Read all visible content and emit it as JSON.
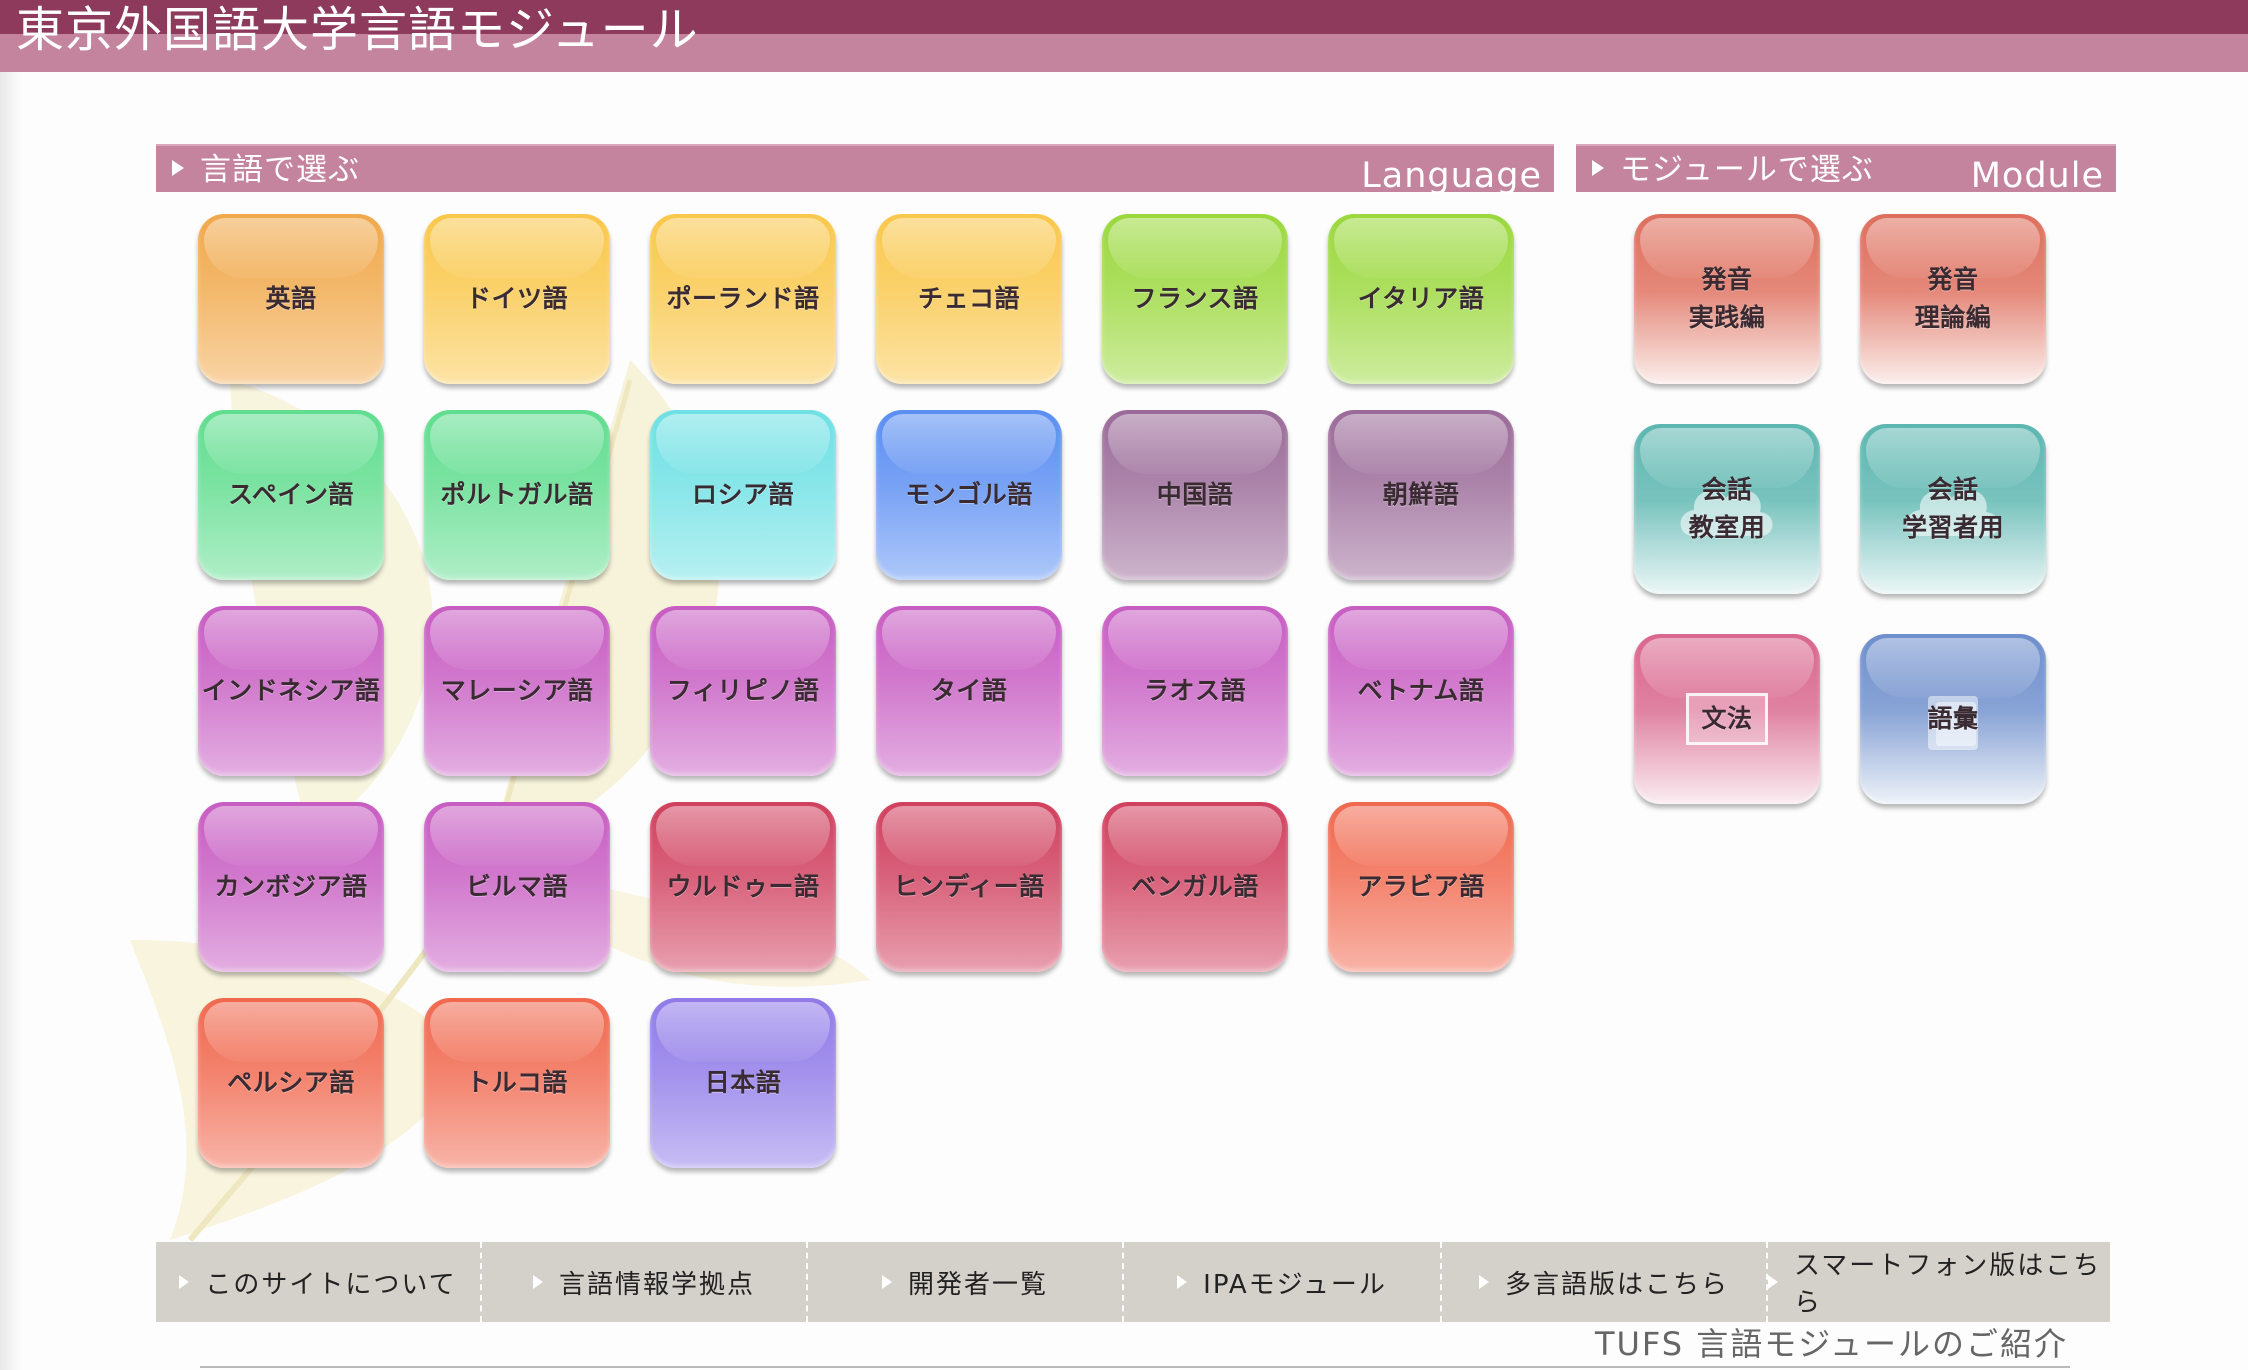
{
  "header": {
    "title": "東京外国語大学言語モジュール"
  },
  "language_section": {
    "label": "言語で選ぶ",
    "label_en": "Language"
  },
  "module_section": {
    "label": "モジュールで選ぶ",
    "label_en": "Module"
  },
  "languages": [
    {
      "label": "英語",
      "color": "#f0a84a"
    },
    {
      "label": "ドイツ語",
      "color": "#f9c74a"
    },
    {
      "label": "ポーランド語",
      "color": "#f9c74a"
    },
    {
      "label": "チェコ語",
      "color": "#f9c74a"
    },
    {
      "label": "フランス語",
      "color": "#9ad83c"
    },
    {
      "label": "イタリア語",
      "color": "#9ad83c"
    },
    {
      "label": "スペイン語",
      "color": "#5fdd8e"
    },
    {
      "label": "ポルトガル語",
      "color": "#5fdd8e"
    },
    {
      "label": "ロシア語",
      "color": "#6ee0e4"
    },
    {
      "label": "モンゴル語",
      "color": "#5a8ef2"
    },
    {
      "label": "中国語",
      "color": "#9a6a98"
    },
    {
      "label": "朝鮮語",
      "color": "#9a6a98"
    },
    {
      "label": "インドネシア語",
      "color": "#c75cc2"
    },
    {
      "label": "マレーシア語",
      "color": "#c75cc2"
    },
    {
      "label": "フィリピノ語",
      "color": "#c75cc2"
    },
    {
      "label": "タイ語",
      "color": "#c75cc2"
    },
    {
      "label": "ラオス語",
      "color": "#c75cc2"
    },
    {
      "label": "ベトナム語",
      "color": "#c75cc2"
    },
    {
      "label": "カンボジア語",
      "color": "#c75cc2"
    },
    {
      "label": "ビルマ語",
      "color": "#c75cc2"
    },
    {
      "label": "ウルドゥー語",
      "color": "#d0405e"
    },
    {
      "label": "ヒンディー語",
      "color": "#d0405e"
    },
    {
      "label": "ベンガル語",
      "color": "#d0405e"
    },
    {
      "label": "アラビア語",
      "color": "#f0684e"
    },
    {
      "label": "ペルシア語",
      "color": "#f0684e"
    },
    {
      "label": "トルコ語",
      "color": "#f0684e"
    },
    {
      "label": "日本語",
      "color": "#8f7ae8"
    }
  ],
  "modules": [
    {
      "label": "発音\n実践編",
      "color": "#de6e5c",
      "icon": "pronunciation-practice-icon"
    },
    {
      "label": "発音\n理論編",
      "color": "#de6e5c",
      "icon": "pronunciation-theory-icon"
    },
    {
      "label": "会話\n教室用",
      "color": "#5cb6b0",
      "icon": "conversation-cloud-icon"
    },
    {
      "label": "会話\n学習者用",
      "color": "#5cb6b0",
      "icon": "conversation-cloud-icon"
    },
    {
      "label": "文法",
      "color": "#d9668e",
      "icon": "grammar-frame-icon"
    },
    {
      "label": "語彙",
      "color": "#6e8fcc",
      "icon": "vocabulary-book-icon"
    }
  ],
  "footer_nav": [
    {
      "label": "このサイトについて"
    },
    {
      "label": "言語情報学拠点"
    },
    {
      "label": "開発者一覧"
    },
    {
      "label": "IPAモジュール"
    },
    {
      "label": "多言語版はこちら"
    },
    {
      "label": "スマートフォン版はこちら"
    }
  ],
  "footer": {
    "caption": "TUFS 言語モジュールのご紹介"
  }
}
